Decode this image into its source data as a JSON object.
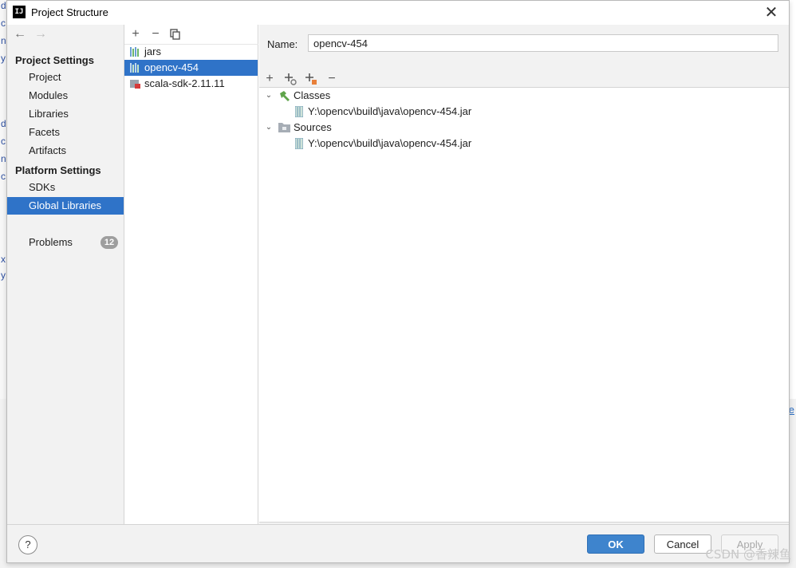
{
  "background": {
    "ide_letters": [
      "d",
      "c",
      "n",
      "y",
      "d",
      "c",
      "n",
      "c",
      "x",
      "y",
      "e",
      "e"
    ],
    "right_link": "e",
    "watermark": "CSDN @香辣鱼"
  },
  "window": {
    "title": "Project Structure",
    "app_icon_text": "IJ",
    "close_icon": "close-icon"
  },
  "sidebar": {
    "back_icon": "arrow-left-icon",
    "forward_icon": "arrow-right-icon",
    "project_settings_header": "Project Settings",
    "project_settings_items": [
      {
        "label": "Project"
      },
      {
        "label": "Modules"
      },
      {
        "label": "Libraries"
      },
      {
        "label": "Facets"
      },
      {
        "label": "Artifacts"
      }
    ],
    "platform_settings_header": "Platform Settings",
    "platform_settings_items": [
      {
        "label": "SDKs"
      },
      {
        "label": "Global Libraries",
        "selected": true
      }
    ],
    "problems": {
      "label": "Problems",
      "count": "12"
    }
  },
  "libraries": {
    "toolbar": {
      "add": "+",
      "remove": "−",
      "copy": "copy-icon"
    },
    "items": [
      {
        "label": "jars",
        "icon": "library-icon"
      },
      {
        "label": "opencv-454",
        "icon": "library-icon",
        "selected": true
      },
      {
        "label": "scala-sdk-2.11.11",
        "icon": "scala-sdk-icon"
      }
    ]
  },
  "detail": {
    "name_label": "Name:",
    "name_value": "opencv-454",
    "toolbar": [
      "add-icon",
      "add-with-settings-icon",
      "add-alternative-icon",
      "remove-icon"
    ],
    "tree": [
      {
        "label": "Classes",
        "icon": "hammer-icon",
        "expanded": true,
        "children": [
          {
            "label": "Y:\\opencv\\build\\java\\opencv-454.jar",
            "icon": "jar-icon"
          }
        ]
      },
      {
        "label": "Sources",
        "icon": "folder-icon",
        "expanded": true,
        "children": [
          {
            "label": "Y:\\opencv\\build\\java\\opencv-454.jar",
            "icon": "jar-icon"
          }
        ]
      }
    ]
  },
  "footer": {
    "help": "?",
    "ok": "OK",
    "cancel": "Cancel",
    "apply": "Apply"
  },
  "colors": {
    "selection": "#2f73c8",
    "ok_button": "#3e84cd",
    "panel_bg": "#f2f2f2"
  }
}
